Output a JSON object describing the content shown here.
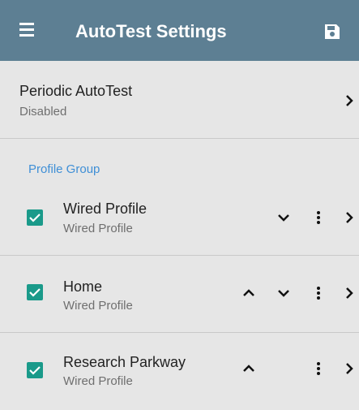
{
  "appbar": {
    "title": "AutoTest Settings",
    "menu_icon": "hamburger-menu-icon",
    "save_icon": "save-floppy-icon",
    "color": "#5d7f93"
  },
  "periodic": {
    "label": "Periodic AutoTest",
    "value": "Disabled"
  },
  "profile_group": {
    "header": "Profile Group",
    "header_color": "#3f8fd6",
    "checkbox_color": "#1a9a8a",
    "items": [
      {
        "name": "Wired Profile",
        "type": "Wired Profile",
        "checked": true,
        "move_up": false,
        "move_down": true
      },
      {
        "name": "Home",
        "type": "Wired Profile",
        "checked": true,
        "move_up": true,
        "move_down": true
      },
      {
        "name": "Research Parkway",
        "type": "Wired Profile",
        "checked": true,
        "move_up": true,
        "move_down": false
      }
    ]
  }
}
